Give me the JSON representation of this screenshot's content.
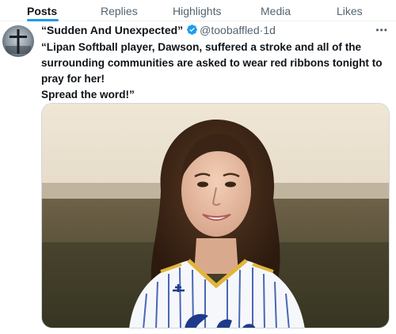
{
  "tabs": [
    {
      "label": "Posts"
    },
    {
      "label": "Replies"
    },
    {
      "label": "Highlights"
    },
    {
      "label": "Media"
    },
    {
      "label": "Likes"
    }
  ],
  "post": {
    "display_name": "“Sudden And Unexpected”",
    "handle": "@toobaffled",
    "separator": "·",
    "time": "1d",
    "text_line1": "“Lipan Softball player, Dawson, suffered a stroke and all of the surrounding communities are asked to wear red ribbons tonight to pray for her!",
    "text_line2": "Spread the word!”"
  },
  "icons": {
    "avatar": "cross-avatar",
    "verified": "verified-badge-icon",
    "more": "more-options-icon"
  },
  "colors": {
    "accent": "#1d9bf0",
    "text_primary": "#0f1419",
    "text_secondary": "#536471"
  }
}
